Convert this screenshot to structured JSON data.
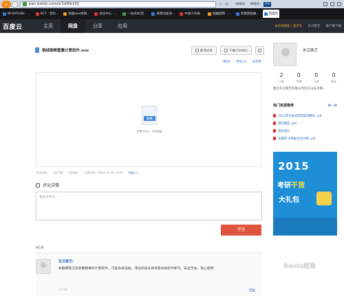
{
  "browser": {
    "url": "pan.baidu.com/s/1d0lb1DJ",
    "speeds": [
      "0KB/S",
      "0KB/S",
      "0%"
    ],
    "tabs": [
      {
        "label": "BP-BYAGBE - ...",
        "color": ""
      },
      {
        "label": "BCT - 百科...",
        "color": "r"
      },
      {
        "label": "很盛wes拼限...",
        "color": "o"
      },
      {
        "label": "会员中心 - ...",
        "color": "r"
      },
      {
        "label": "一站式IB/音...",
        "color": "g"
      },
      {
        "label": "关键词查询...",
        "color": ""
      },
      {
        "label": "中规汽车格...",
        "color": "r"
      },
      {
        "label": "缩姻剧韩 - ...",
        "color": "o"
      },
      {
        "label": "的偶原服阁...",
        "color": ""
      },
      {
        "label": "百度云",
        "color": "",
        "active": true
      }
    ]
  },
  "nav": {
    "logo": "百度云",
    "tabs": [
      "主页",
      "网盘",
      "分享",
      "应用"
    ],
    "vip": "永乐网盘版 | 直开礼",
    "user": "东汉铁艺",
    "client": "客户端下载"
  },
  "file": {
    "name": "钢绒钢棒重量计算软件.exe",
    "cancel_share": "取消分享",
    "download": "下载(550KB)",
    "likes": "赞(0)",
    "comments": "评论(1)",
    "share_to": "分享至",
    "ext": "EXE",
    "size_text": "文件大小：550KB",
    "stats": [
      "17次浏览",
      "0次下载",
      "0次保存",
      "分享时间：2014-11-29 12:58"
    ],
    "report": "举报>>"
  },
  "comment_section": {
    "title": "评论详情",
    "placeholder": "我来评两句~",
    "submit": "评论",
    "count": "共1条",
    "comments": [
      {
        "user": "东汉铁艺:",
        "text": "新翻钢铁沉及新翻钢棒的计算软件，可能会被误报，添加到白名单或者杀毒软件即可，安全无毒，放心使用",
        "time": "12:59",
        "reply": "回复"
      }
    ]
  },
  "sidebar": {
    "name": "东汉铁艺",
    "stats": [
      {
        "value": "2",
        "label": "分享"
      },
      {
        "value": "0",
        "label": "专辑"
      },
      {
        "value": "0",
        "label": "订阅"
      },
      {
        "value": "0",
        "label": "粉丝"
      }
    ],
    "description": "意兰东汉铁艺有限公司位于山东济南...",
    "hot_title": "热门资源推荐",
    "more": "换一换",
    "hot_items": [
      "2012年社会化营销案例精选 .pdf",
      "课堂教案 .pdf",
      "商标登记",
      "动漫吧-龙珠超百合文物 .pdf"
    ],
    "ad": {
      "year": "2015",
      "line1_a": "考研",
      "line1_b": "干货",
      "line2": "大礼包"
    }
  },
  "watermark": "Baidu经验"
}
